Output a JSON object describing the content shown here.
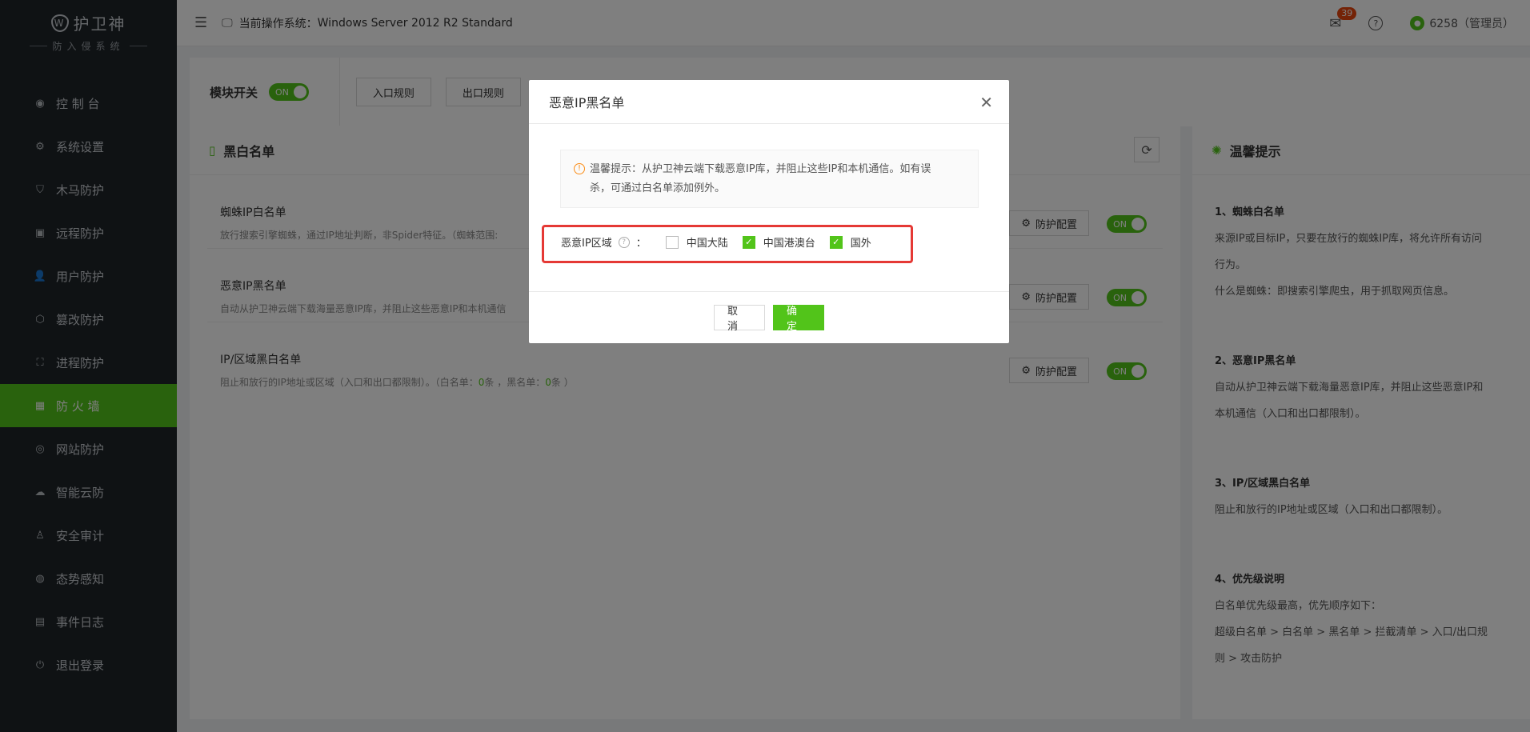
{
  "logo": {
    "title": "护卫神",
    "subtitle": "防入侵系统"
  },
  "nav": [
    {
      "label": "控 制 台",
      "icon": "dashboard-icon"
    },
    {
      "label": "系统设置",
      "icon": "gear-icon"
    },
    {
      "label": "木马防护",
      "icon": "shield-icon"
    },
    {
      "label": "远程防护",
      "icon": "remote-icon"
    },
    {
      "label": "用户防护",
      "icon": "user-icon"
    },
    {
      "label": "篡改防护",
      "icon": "tamper-icon"
    },
    {
      "label": "进程防护",
      "icon": "process-icon"
    },
    {
      "label": "防 火 墙",
      "icon": "firewall-icon",
      "active": true
    },
    {
      "label": "网站防护",
      "icon": "globe-icon"
    },
    {
      "label": "智能云防",
      "icon": "cloud-icon"
    },
    {
      "label": "安全审计",
      "icon": "audit-icon"
    },
    {
      "label": "态势感知",
      "icon": "radar-icon"
    },
    {
      "label": "事件日志",
      "icon": "log-icon"
    },
    {
      "label": "退出登录",
      "icon": "logout-icon"
    }
  ],
  "header": {
    "os_prefix": "当前操作系统：",
    "os_name": "Windows Server 2012 R2 Standard",
    "mail_count": "39",
    "user": "6258（管理员）"
  },
  "module": {
    "label": "模块开关",
    "toggle": "ON",
    "tabs": [
      "入口规则",
      "出口规则"
    ]
  },
  "list_panel": {
    "title": "黑白名单",
    "config_label": "防护配置",
    "toggle": "ON",
    "rows": [
      {
        "title": "蜘蛛IP白名单",
        "desc": "放行搜索引擎蜘蛛，通过IP地址判断，非Spider特征。（蜘蛛范围:"
      },
      {
        "title": "恶意IP黑名单",
        "desc": "自动从护卫神云端下载海量恶意IP库，并阻止这些恶意IP和本机通信"
      },
      {
        "title": "IP/区域黑白名单",
        "desc_a": "阻止和放行的IP地址或区域（入口和出口都限制）。（白名单：",
        "white": "0",
        "desc_b": "条 ，黑名单：",
        "black": "0",
        "desc_c": "条 ）"
      }
    ]
  },
  "tips": {
    "title": "温馨提示",
    "s1_title": "1、蜘蛛白名单",
    "s1_l1": "来源IP或目标IP，只要在放行的蜘蛛IP库，将允许所有访问",
    "s1_l2": "行为。",
    "s1_l3": "什么是蜘蛛：即搜索引擎爬虫，用于抓取网页信息。",
    "s2_title": "2、恶意IP黑名单",
    "s2_l1": "自动从护卫神云端下载海量恶意IP库，并阻止这些恶意IP和",
    "s2_l2": "本机通信（入口和出口都限制）。",
    "s3_title": "3、IP/区域黑白名单",
    "s3_l1": "阻止和放行的IP地址或区域（入口和出口都限制）。",
    "s4_title": "4、优先级说明",
    "s4_l1": "白名单优先级最高，优先顺序如下：",
    "s4_l2": "超级白名单 > 白名单 > 黑名单 > 拦截清单 > 入口/出口规",
    "s4_l3": "则 > 攻击防护"
  },
  "modal": {
    "title": "恶意IP黑名单",
    "notice_l1": "温馨提示：从护卫神云端下载恶意IP库，并阻止这些IP和本机通信。如有误",
    "notice_l2": "杀，可通过白名单添加例外。",
    "region_label": "恶意IP区域",
    "colon": "：",
    "options": [
      {
        "label": "中国大陆",
        "checked": false
      },
      {
        "label": "中国港澳台",
        "checked": true
      },
      {
        "label": "国外",
        "checked": true
      }
    ],
    "cancel": "取 消",
    "ok": "确 定"
  }
}
